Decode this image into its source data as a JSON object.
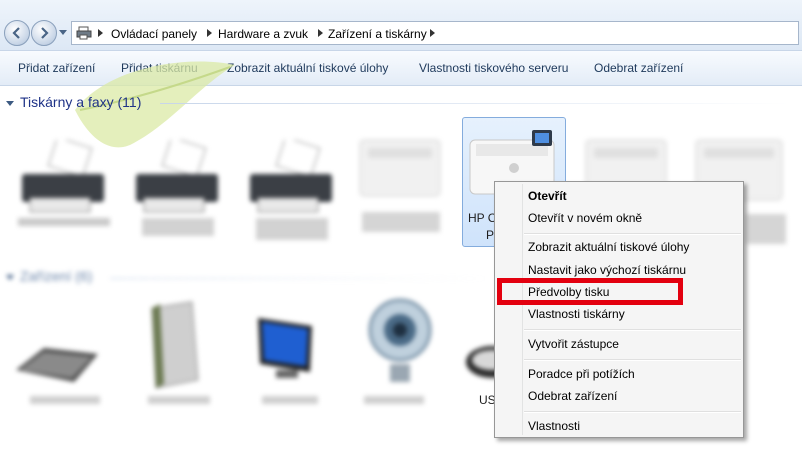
{
  "address": {
    "crumbs": [
      "Ovládací panely",
      "Hardware a zvuk",
      "Zařízení a tiskárny"
    ]
  },
  "toolbar": {
    "items": [
      "Přidat zařízení",
      "Přidat tiskárnu",
      "Zobrazit aktuální tiskové úlohy",
      "Vlastnosti tiskového serveru",
      "Odebrat zařízení"
    ]
  },
  "groups": {
    "printers_header": "Tiskárny a faxy (11)",
    "devices_header": "Zařízení (6)"
  },
  "selected": {
    "label_line1": "HP C",
    "label_line2": "P"
  },
  "partial": {
    "usb_label": "US"
  },
  "context_menu": {
    "items": [
      {
        "label": "Otevřít",
        "bold": true
      },
      {
        "label": "Otevřít v novém okně"
      },
      {
        "label": "Zobrazit aktuální tiskové úlohy"
      },
      {
        "label": "Nastavit jako výchozí tiskárnu"
      },
      {
        "label": "Předvolby tisku"
      },
      {
        "label": "Vlastnosti tiskárny"
      },
      {
        "label": "Vytvořit zástupce"
      },
      {
        "label": "Poradce při potížích"
      },
      {
        "label": "Odebrat zařízení"
      },
      {
        "label": "Vlastnosti"
      }
    ]
  },
  "colors": {
    "highlight": "#e3000f",
    "group_header": "#1e3287",
    "accent": "#84acdd"
  }
}
